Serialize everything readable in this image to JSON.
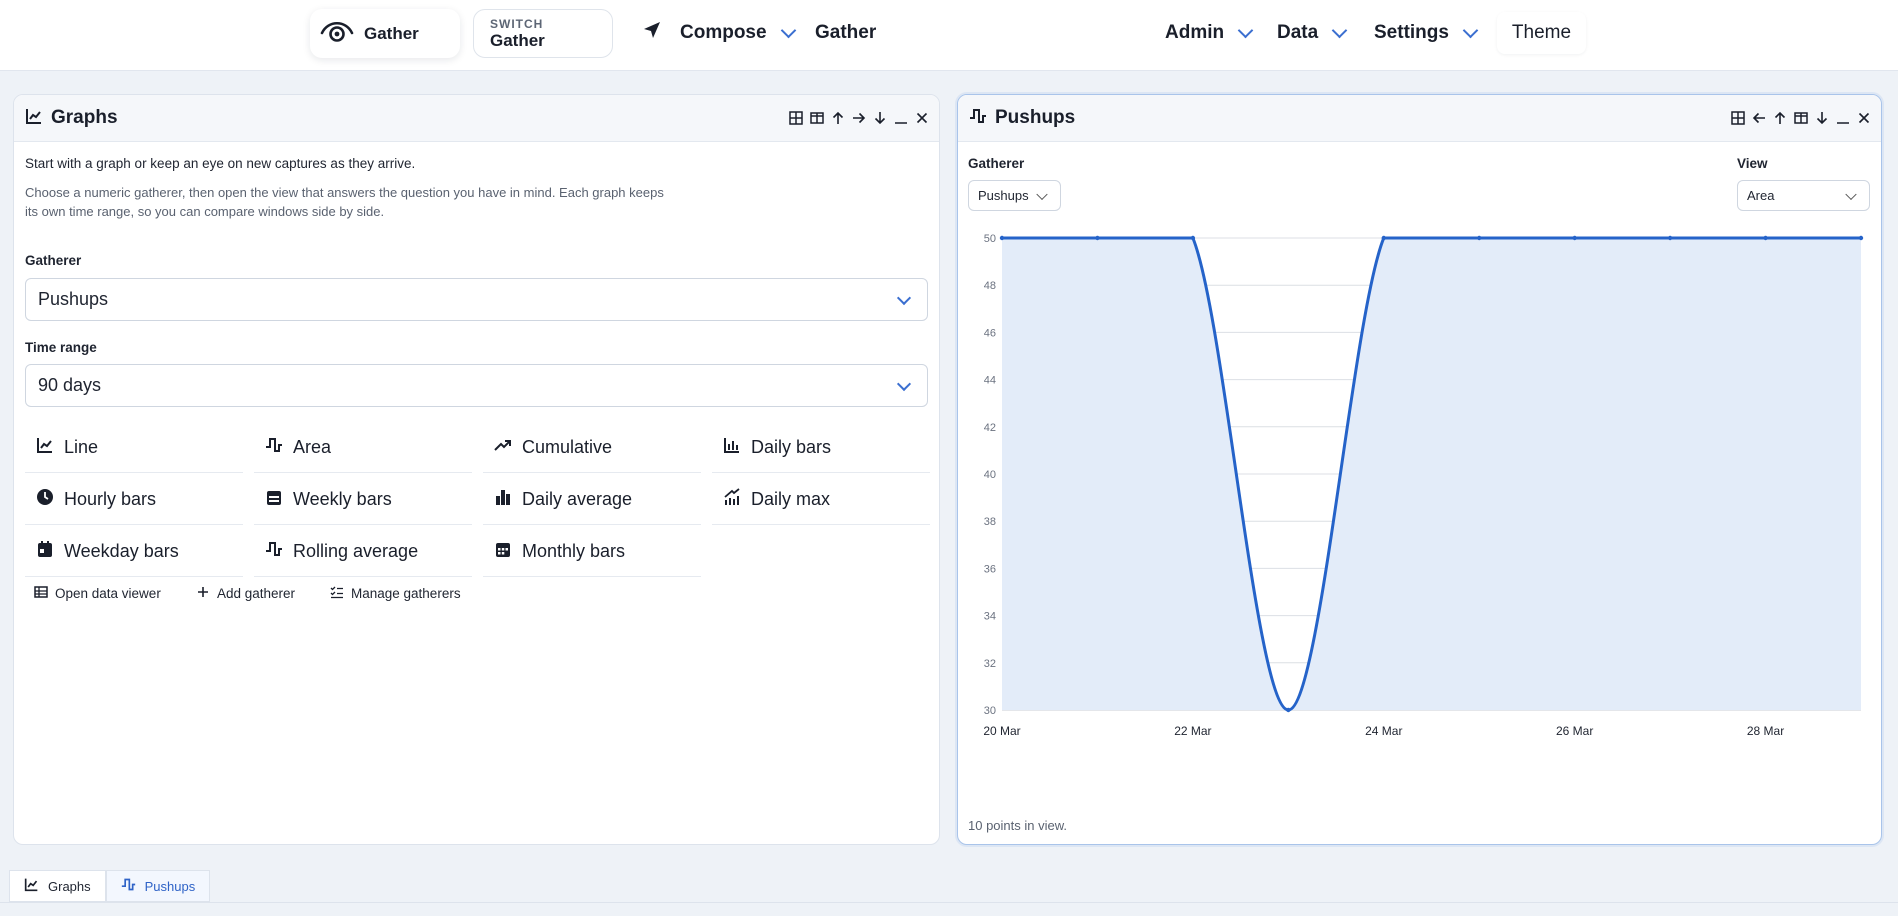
{
  "header": {
    "brand": {
      "label": "Gather",
      "icon": "eye-icon"
    },
    "switch": {
      "kicker": "SWITCH",
      "value": "Gather"
    },
    "nav": {
      "compose": "Compose",
      "gather": "Gather",
      "admin": "Admin",
      "data": "Data",
      "settings": "Settings",
      "theme": "Theme"
    }
  },
  "graphs_panel": {
    "title": "Graphs",
    "intro": "Start with a graph or keep an eye on new captures as they arrive.",
    "description": "Choose a numeric gatherer, then open the view that answers the question you have in mind. Each graph keeps its own time range, so you can compare windows side by side.",
    "gatherer_label": "Gatherer",
    "gatherer_value": "Pushups",
    "time_range_label": "Time range",
    "time_range_value": "90 days",
    "views": [
      {
        "label": "Line",
        "icon": "line-chart-icon"
      },
      {
        "label": "Area",
        "icon": "area-icon"
      },
      {
        "label": "Cumulative",
        "icon": "trend-up-icon"
      },
      {
        "label": "Daily bars",
        "icon": "bar-chart-icon"
      },
      {
        "label": "Hourly bars",
        "icon": "clock-icon"
      },
      {
        "label": "Weekly bars",
        "icon": "calendar-week-icon"
      },
      {
        "label": "Daily average",
        "icon": "column-chart-icon"
      },
      {
        "label": "Daily max",
        "icon": "max-chart-icon"
      },
      {
        "label": "Weekday bars",
        "icon": "calendar-day-icon"
      },
      {
        "label": "Rolling average",
        "icon": "rolling-icon"
      },
      {
        "label": "Monthly bars",
        "icon": "calendar-month-icon"
      }
    ],
    "utilities": {
      "open_data_viewer": "Open data viewer",
      "add_gatherer": "Add gatherer",
      "manage_gatherers": "Manage gatherers"
    }
  },
  "pushups_panel": {
    "title": "Pushups",
    "gatherer_label": "Gatherer",
    "gatherer_value": "Pushups",
    "view_label": "View",
    "view_value": "Area",
    "footnote": "10 points in view."
  },
  "chart_data": {
    "type": "area",
    "title": "",
    "xlabel": "",
    "ylabel": "",
    "x": [
      "20 Mar",
      "21 Mar",
      "22 Mar",
      "23 Mar",
      "24 Mar",
      "25 Mar",
      "26 Mar",
      "27 Mar",
      "28 Mar",
      "29 Mar"
    ],
    "x_tick_labels": [
      "20 Mar",
      "22 Mar",
      "24 Mar",
      "26 Mar",
      "28 Mar"
    ],
    "y_ticks": [
      30,
      32,
      34,
      36,
      38,
      40,
      42,
      44,
      46,
      48,
      50
    ],
    "values": [
      50,
      50,
      50,
      30,
      50,
      50,
      50,
      50,
      50,
      50
    ],
    "ylim": [
      30,
      50
    ],
    "grid": true,
    "colors": {
      "line": "#2563c9",
      "fill": "#e3ecf9"
    }
  },
  "bottom_tabs": [
    {
      "label": "Graphs",
      "icon": "line-chart-icon",
      "active": false
    },
    {
      "label": "Pushups",
      "icon": "area-icon",
      "active": true
    }
  ]
}
